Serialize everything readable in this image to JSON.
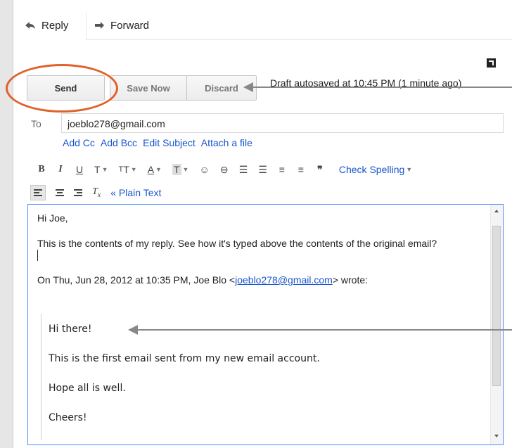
{
  "tabs": [
    {
      "label": "Reply",
      "icon": "reply-arrow-icon"
    },
    {
      "label": "Forward",
      "icon": "forward-arrow-icon"
    }
  ],
  "actions": {
    "send": "Send",
    "save_now": "Save Now",
    "discard": "Discard",
    "autosave_status": "Draft autosaved at 10:45 PM (1 minute ago)"
  },
  "recipient": {
    "to_label": "To",
    "to_value": "joeblo278@gmail.com",
    "links": [
      "Add Cc",
      "Add Bcc",
      "Edit Subject",
      "Attach a file"
    ]
  },
  "toolbar": {
    "check_spelling": "Check Spelling",
    "plain_text": "« Plain Text"
  },
  "message": {
    "greeting": "Hi Joe,",
    "body": "This is the contents of my reply. See how it's typed above the contents of the original email?",
    "quote_header_prefix": "On Thu, Jun 28, 2012 at 10:35 PM, Joe Blo <",
    "quote_email": "joeblo278@gmail.com",
    "quote_header_suffix": "> wrote:",
    "quoted_lines": [
      "Hi there!",
      "This is the first email sent from my new email account.",
      "Hope all is well.",
      "Cheers!"
    ]
  },
  "colors": {
    "highlight": "#e0622a",
    "link": "#1a55cc",
    "focus_border": "#4d90fe"
  }
}
